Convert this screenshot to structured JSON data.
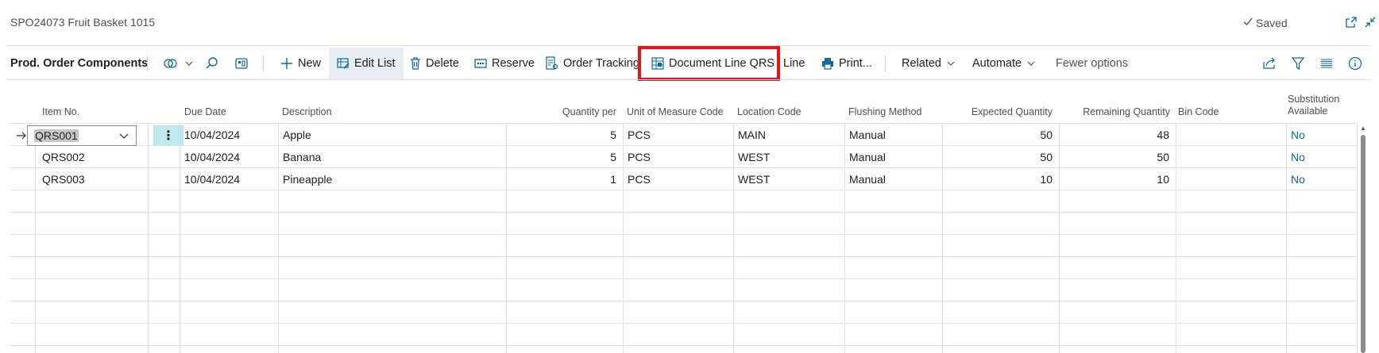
{
  "header": {
    "title": "SPO24073 Fruit Basket 1015",
    "saved_label": "Saved"
  },
  "toolbar": {
    "page_title": "Prod. Order Components",
    "new_label": "New",
    "edit_list_label": "Edit List",
    "delete_label": "Delete",
    "reserve_label": "Reserve",
    "order_tracking_label": "Order Tracking",
    "document_line_qrs_label": "Document Line QRS",
    "line_label": "Line",
    "print_label": "Print...",
    "related_label": "Related",
    "automate_label": "Automate",
    "fewer_options_label": "Fewer options"
  },
  "table": {
    "columns": {
      "item_no": "Item No.",
      "due_date": "Due Date",
      "description": "Description",
      "quantity_per": "Quantity per",
      "uom": "Unit of Measure Code",
      "location": "Location Code",
      "flushing": "Flushing Method",
      "expected_qty": "Expected Quantity",
      "remaining_qty": "Remaining Quantity",
      "bin_code": "Bin Code",
      "substitution": "Substitution Available"
    },
    "rows": [
      {
        "item_no": "QRS001",
        "due_date": "10/04/2024",
        "description": "Apple",
        "quantity_per": "5",
        "uom": "PCS",
        "location": "MAIN",
        "flushing": "Manual",
        "expected_qty": "50",
        "remaining_qty": "48",
        "bin_code": "",
        "substitution": "No"
      },
      {
        "item_no": "QRS002",
        "due_date": "10/04/2024",
        "description": "Banana",
        "quantity_per": "5",
        "uom": "PCS",
        "location": "WEST",
        "flushing": "Manual",
        "expected_qty": "50",
        "remaining_qty": "50",
        "bin_code": "",
        "substitution": "No"
      },
      {
        "item_no": "QRS003",
        "due_date": "10/04/2024",
        "description": "Pineapple",
        "quantity_per": "1",
        "uom": "PCS",
        "location": "WEST",
        "flushing": "Manual",
        "expected_qty": "10",
        "remaining_qty": "10",
        "bin_code": "",
        "substitution": "No"
      }
    ]
  },
  "colors": {
    "accent": "#0b6a9e",
    "highlight": "#e8141c",
    "selected_cell": "#bfe9ee"
  },
  "icons": {
    "saved": "checkmark-icon",
    "share": "open-in-new-icon",
    "collapse": "collapse-icon",
    "view": "view-options-icon",
    "search": "search-icon",
    "personalize": "personalize-icon",
    "new": "plus-icon",
    "edit_list": "edit-list-icon",
    "delete": "trash-icon",
    "reserve": "reserve-icon",
    "order_tracking": "order-tracking-icon",
    "document_line_qrs": "document-grid-icon",
    "print": "printer-icon",
    "share_right": "share-icon",
    "filter": "filter-icon",
    "list": "list-icon",
    "info": "info-icon"
  }
}
